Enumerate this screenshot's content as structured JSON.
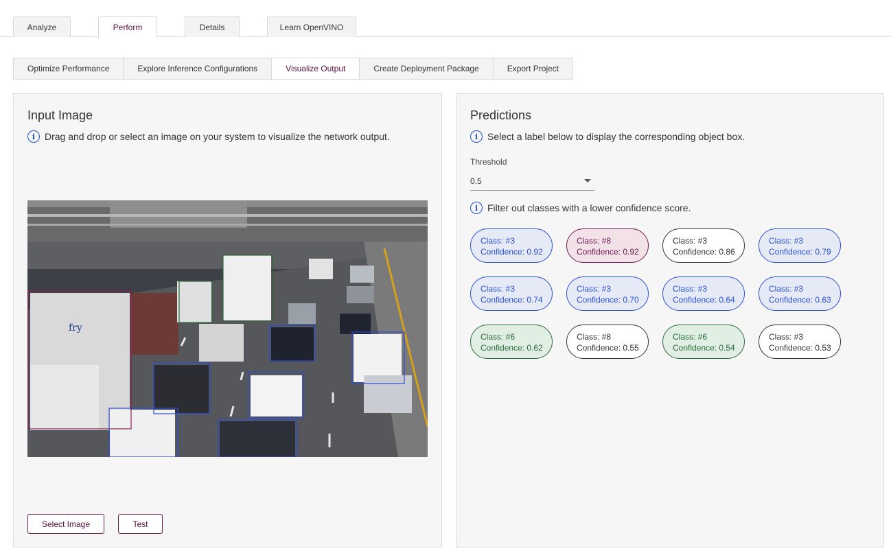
{
  "top_tabs": [
    "Analyze",
    "Perform",
    "Details",
    "Learn OpenVINO"
  ],
  "top_tabs_active": "Perform",
  "sub_tabs": [
    "Optimize Performance",
    "Explore Inference Configurations",
    "Visualize Output",
    "Create Deployment Package",
    "Export Project"
  ],
  "sub_tabs_active": "Visualize Output",
  "input_panel": {
    "title": "Input Image",
    "hint": "Drag and drop or select an image on your system to visualize the network output.",
    "select_button": "Select Image",
    "test_button": "Test"
  },
  "predictions_panel": {
    "title": "Predictions",
    "hint": "Select a label below to display the corresponding object box.",
    "threshold_label": "Threshold",
    "threshold_value": "0.5",
    "filter_hint": "Filter out classes with a lower confidence score."
  },
  "predictions": [
    {
      "class": "Class: #3",
      "confidence": "Confidence: 0.92",
      "style": "blue"
    },
    {
      "class": "Class: #8",
      "confidence": "Confidence: 0.92",
      "style": "red"
    },
    {
      "class": "Class: #3",
      "confidence": "Confidence: 0.86",
      "style": "white"
    },
    {
      "class": "Class: #3",
      "confidence": "Confidence: 0.79",
      "style": "blue"
    },
    {
      "class": "Class: #3",
      "confidence": "Confidence: 0.74",
      "style": "blue"
    },
    {
      "class": "Class: #3",
      "confidence": "Confidence: 0.70",
      "style": "blue"
    },
    {
      "class": "Class: #3",
      "confidence": "Confidence: 0.64",
      "style": "blue"
    },
    {
      "class": "Class: #3",
      "confidence": "Confidence: 0.63",
      "style": "blue"
    },
    {
      "class": "Class: #6",
      "confidence": "Confidence: 0.62",
      "style": "green"
    },
    {
      "class": "Class: #8",
      "confidence": "Confidence: 0.55",
      "style": "white"
    },
    {
      "class": "Class: #6",
      "confidence": "Confidence: 0.54",
      "style": "green"
    },
    {
      "class": "Class: #3",
      "confidence": "Confidence: 0.53",
      "style": "white"
    }
  ],
  "colors": {
    "accent": "#5b1244",
    "blue_box": "#2a4fd1",
    "red_box": "#8a1f54",
    "green_box": "#2a6b3a",
    "info_icon": "#1d4fc9"
  },
  "image_truck_text": "fry"
}
